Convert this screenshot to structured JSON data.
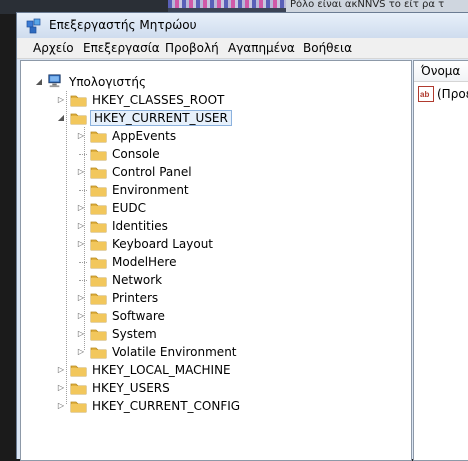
{
  "background": {
    "right_text_fragment": "Ρόλο είναι ακΝΝVS το είτ ρα τ"
  },
  "window": {
    "title": "Επεξεργαστής Μητρώου"
  },
  "menu": [
    "Αρχείο",
    "Επεξεργασία",
    "Προβολή",
    "Αγαπημένα",
    "Βοήθεια"
  ],
  "tree": {
    "root": "Υπολογιστής",
    "hives": [
      {
        "label": "HKEY_CLASSES_ROOT",
        "expanded": false
      },
      {
        "label": "HKEY_CURRENT_USER",
        "expanded": true,
        "selected": true
      },
      {
        "label": "HKEY_LOCAL_MACHINE",
        "expanded": false
      },
      {
        "label": "HKEY_USERS",
        "expanded": false
      },
      {
        "label": "HKEY_CURRENT_CONFIG",
        "expanded": false
      }
    ],
    "current_user_children": [
      {
        "label": "AppEvents",
        "has_children": true
      },
      {
        "label": "Console",
        "has_children": false
      },
      {
        "label": "Control Panel",
        "has_children": true
      },
      {
        "label": "Environment",
        "has_children": false
      },
      {
        "label": "EUDC",
        "has_children": true
      },
      {
        "label": "Identities",
        "has_children": true
      },
      {
        "label": "Keyboard Layout",
        "has_children": true
      },
      {
        "label": "ModelHere",
        "has_children": false
      },
      {
        "label": "Network",
        "has_children": false
      },
      {
        "label": "Printers",
        "has_children": true
      },
      {
        "label": "Software",
        "has_children": true
      },
      {
        "label": "System",
        "has_children": true
      },
      {
        "label": "Volatile Environment",
        "has_children": true
      }
    ]
  },
  "list": {
    "column_name": "Όνομα",
    "rows": [
      {
        "name": "(Προεπιλογή)",
        "icon": "string-value-icon"
      }
    ]
  },
  "colors": {
    "selection_bg": "#e6f0fb",
    "selection_border": "#8cb2de",
    "folder": "#f2c75c"
  }
}
